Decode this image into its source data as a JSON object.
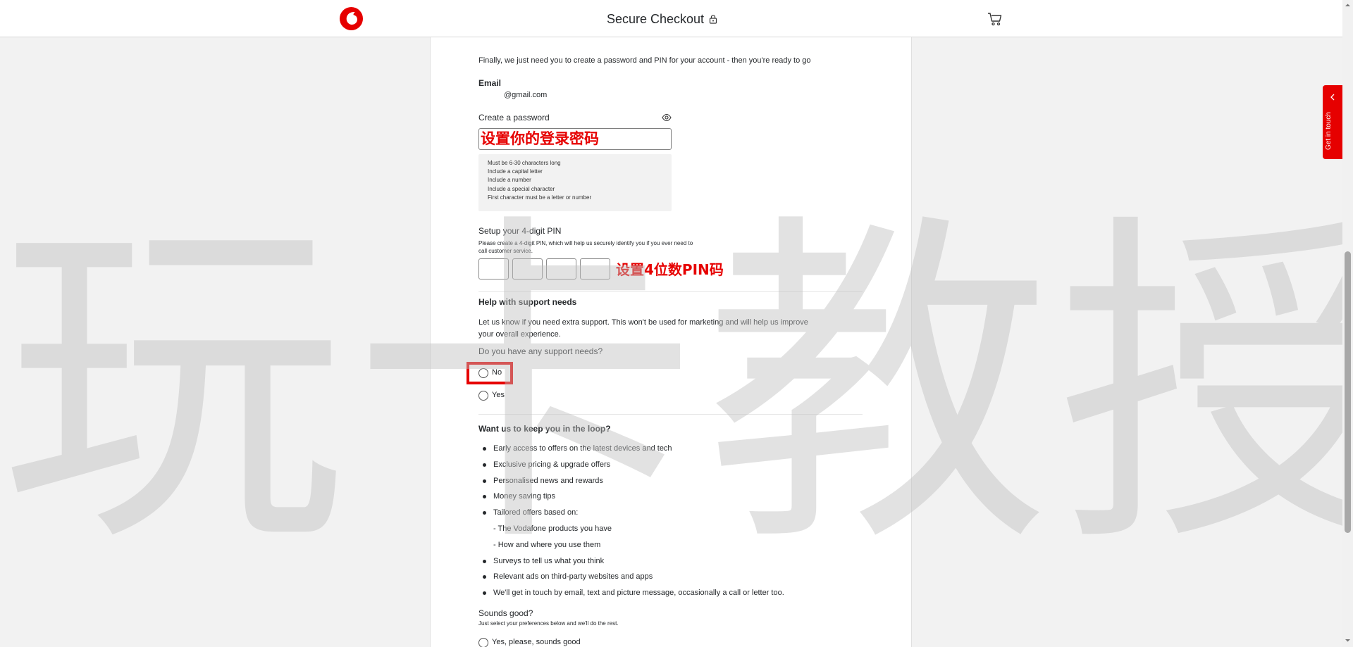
{
  "header": {
    "title": "Secure Checkout",
    "brand_color": "#e60000"
  },
  "form": {
    "intro": "Finally, we just need you to create a password and PIN for your account - then you're ready to go",
    "email_label": "Email",
    "email_value": "@gmail.com",
    "password_label": "Create a password",
    "password_annotation": "设置你的登录密码",
    "password_rules": [
      "Must be 6-30 characters long",
      "Include a capital letter",
      "Include a number",
      "Include a special character",
      "First character must be a letter or number"
    ],
    "pin_label": "Setup your 4-digit PIN",
    "pin_help_line1": "Please create a 4-digit PIN, which will help us securely identify you if you ever need to",
    "pin_help_line2": "call customer service.",
    "pin_annotation": "设置4位数PIN码"
  },
  "support": {
    "heading": "Help with support needs",
    "desc_line1": "Let us know if you need extra support. This won't be used for marketing and will help us improve",
    "desc_line2": "your overall experience.",
    "question": "Do you have any support needs?",
    "option_no": "No",
    "option_yes": "Yes"
  },
  "loop": {
    "heading": "Want us to keep you in the loop?",
    "items": [
      "Early access to offers on the latest devices and tech",
      "Exclusive pricing & upgrade offers",
      "Personalised news and rewards",
      "Money saving tips",
      "Tailored offers based on:",
      "- The Vodafone products you have",
      "- How and where you use them",
      "Surveys to tell us what you think",
      "Relevant ads on third-party websites and apps",
      "We'll get in touch by email, text and picture message, occasionally a call or letter too."
    ],
    "sounds_good": "Sounds good?",
    "sounds_good_sub": "Just select your preferences below and we'll do the rest.",
    "option_yes_please": "Yes, please, sounds good"
  },
  "side_tab": {
    "label": "Get in touch"
  },
  "watermark": {
    "text": "玩卡教授"
  }
}
